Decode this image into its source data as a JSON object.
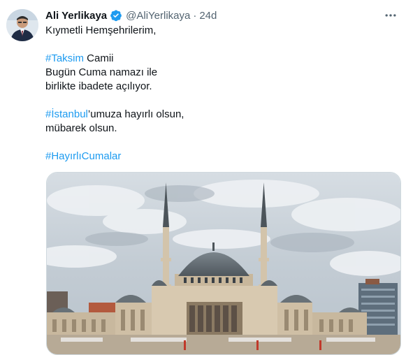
{
  "tweet": {
    "author_name": "Ali Yerlikaya",
    "handle": "@AliYerlikaya",
    "separator": "·",
    "time": "24d",
    "verified": true,
    "lines": {
      "greeting": "Kıymetli Hemşehrilerim,",
      "hashtag_taksim": "#Taksim",
      "taksim_rest": " Camii",
      "line_bugun": "Bugün Cuma namazı ile",
      "line_birlikte": "birlikte ibadete açılıyor.",
      "hashtag_istanbul": "#İstanbul",
      "istanbul_rest": "’umuza hayırlı olsun,",
      "line_mubarek": "mübarek olsun.",
      "hashtag_cuma": "#HayırlıCumalar"
    }
  },
  "colors": {
    "link": "#1d9bf0",
    "secondary_text": "#536471",
    "verified_badge": "#1d9bf0"
  },
  "icons": {
    "verified": "verified-badge-icon",
    "more": "more-options-icon"
  }
}
